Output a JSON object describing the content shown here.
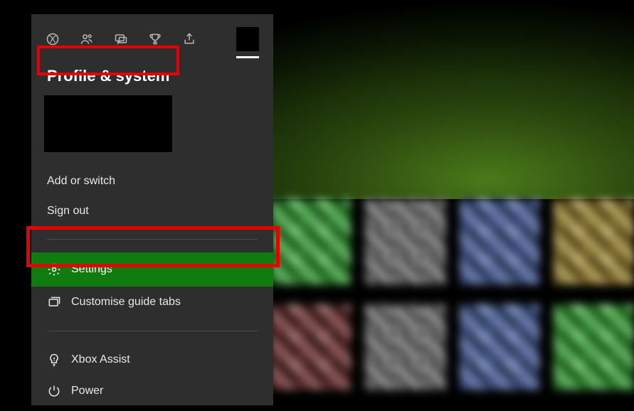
{
  "panel": {
    "title": "Profile & system",
    "tabs": [
      {
        "name": "xbox-icon"
      },
      {
        "name": "people-icon"
      },
      {
        "name": "chat-icon"
      },
      {
        "name": "trophy-icon"
      },
      {
        "name": "share-icon"
      }
    ],
    "account": {
      "add_or_switch": "Add or switch",
      "sign_out": "Sign out"
    },
    "items": {
      "settings": "Settings",
      "customise_guide_tabs": "Customise guide tabs",
      "xbox_assist": "Xbox Assist",
      "power": "Power"
    }
  },
  "highlights": {
    "title": true,
    "settings": true
  },
  "colors": {
    "panel_bg": "#2e2e2e",
    "accent_green": "#107c10",
    "highlight_red": "#e80000"
  }
}
